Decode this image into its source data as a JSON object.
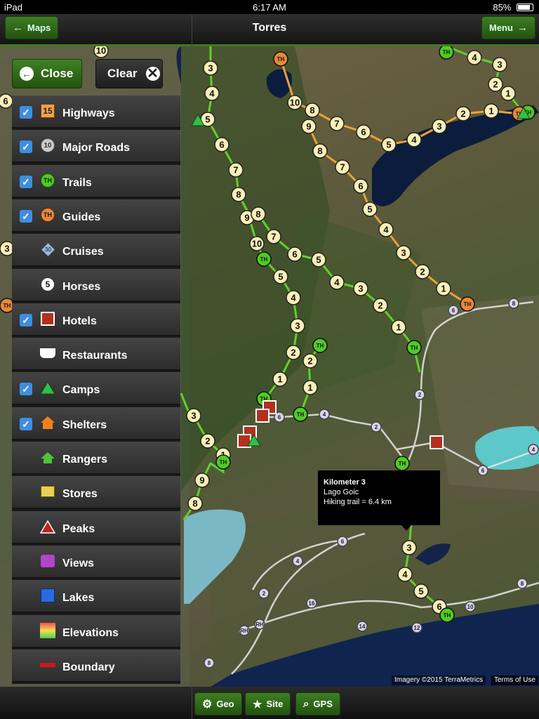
{
  "status": {
    "device": "iPad",
    "time": "6:17 AM",
    "battery": "85%"
  },
  "nav": {
    "back_label": "Maps",
    "title": "Torres",
    "menu_label": "Menu"
  },
  "panel": {
    "close_label": "Close",
    "clear_label": "Clear",
    "layers": [
      {
        "label": "Highways",
        "checked": true,
        "icon": "highway-icon",
        "glyph": "15"
      },
      {
        "label": "Major Roads",
        "checked": true,
        "icon": "major-road-icon",
        "glyph": "10"
      },
      {
        "label": "Trails",
        "checked": true,
        "icon": "trail-icon",
        "glyph": "TH"
      },
      {
        "label": "Guides",
        "checked": true,
        "icon": "guide-icon",
        "glyph": "TH"
      },
      {
        "label": "Cruises",
        "checked": false,
        "icon": "cruise-icon",
        "glyph": "30"
      },
      {
        "label": "Horses",
        "checked": false,
        "icon": "horse-icon",
        "glyph": "5"
      },
      {
        "label": "Hotels",
        "checked": true,
        "icon": "hotel-icon",
        "glyph": ""
      },
      {
        "label": "Restaurants",
        "checked": false,
        "icon": "restaurant-icon",
        "glyph": ""
      },
      {
        "label": "Camps",
        "checked": true,
        "icon": "camp-icon",
        "glyph": ""
      },
      {
        "label": "Shelters",
        "checked": true,
        "icon": "shelter-icon",
        "glyph": ""
      },
      {
        "label": "Rangers",
        "checked": false,
        "icon": "ranger-icon",
        "glyph": ""
      },
      {
        "label": "Stores",
        "checked": false,
        "icon": "store-icon",
        "glyph": ""
      },
      {
        "label": "Peaks",
        "checked": false,
        "icon": "peak-icon",
        "glyph": ""
      },
      {
        "label": "Views",
        "checked": false,
        "icon": "view-icon",
        "glyph": ""
      },
      {
        "label": "Lakes",
        "checked": false,
        "icon": "lake-icon",
        "glyph": ""
      },
      {
        "label": "Elevations",
        "checked": false,
        "icon": "elevation-icon",
        "glyph": ""
      },
      {
        "label": "Boundary",
        "checked": false,
        "icon": "boundary-icon",
        "glyph": ""
      }
    ]
  },
  "tooltip": {
    "title": "Kilometer 3",
    "line1": "Lago Goic",
    "line2": "Hiking trail = 6.4 km"
  },
  "credits": {
    "imagery": "Imagery ©2015 TerraMetrics",
    "terms": "Terms of Use"
  },
  "toolbar": {
    "geo_label": "Geo",
    "site_label": "Site",
    "gps_label": "GPS"
  },
  "colors": {
    "accent_green": "#3e7a1e",
    "trail_green": "#5fd12b",
    "guide_orange": "#e8a23a",
    "checkbox_blue": "#3d8ee0"
  }
}
